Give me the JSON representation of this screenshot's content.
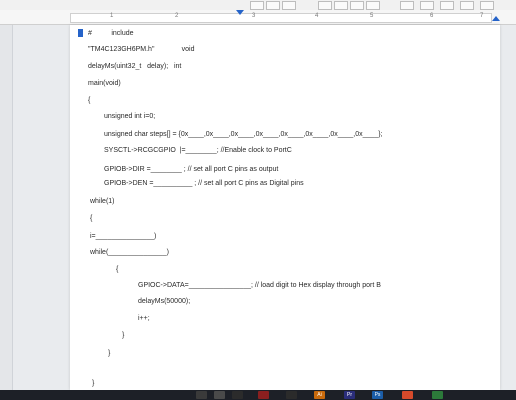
{
  "ruler": {
    "ticks": [
      "1",
      "2",
      "3",
      "4",
      "5",
      "6",
      "7"
    ]
  },
  "code": {
    "line1": "#          include",
    "line2": "\"TM4C123GH6PM.h\"              void",
    "line3": "delayMs(uint32_t   delay);   int",
    "line4": "main(void)",
    "line5": "{",
    "line6": "unsigned int i=0;",
    "line7": "unsigned char steps[] = {0x____,0x____,0x____,0x____,0x____,0x____,0x____,0x____};",
    "line8": "SYSCTL->RCGCGPIO  |=________; //Enable clock to PortC",
    "line9": "GPIOB->DIR =________ ; // set all port C pins as output",
    "line10": "GPIOB->DEN =__________ ; // set all port C pins as Digital pins",
    "line11": "while(1)",
    "line12": "{",
    "line13": "i=_______________)",
    "line14": "while(_______________)",
    "line15": "{",
    "line16": "GPIOC->DATA=________________; // load digit to Hex display through port B",
    "line17": "delayMs(50000);",
    "line18": "i++;",
    "line19": "}",
    "line20": "}",
    "line21": "}"
  },
  "taskbar": {
    "apps": [
      "Ai",
      "Pr",
      "Ps"
    ]
  }
}
